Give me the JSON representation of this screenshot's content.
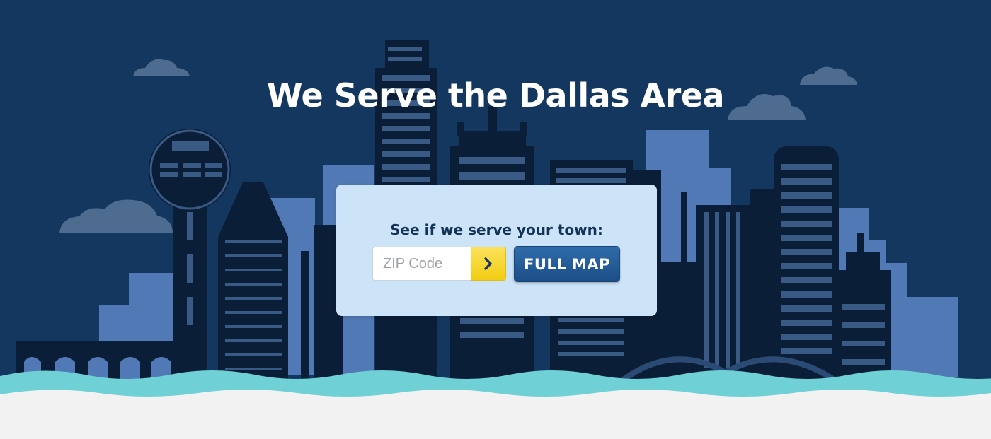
{
  "hero": {
    "title": "We Serve the Dallas Area"
  },
  "zip_search": {
    "heading": "See if we serve your town:",
    "input_placeholder": "ZIP Code",
    "input_value": "",
    "go_icon": "chevron-right-icon",
    "full_map_label": "FULL MAP"
  },
  "colors": {
    "sky": "#14375f",
    "building_dark": "#0b1e37",
    "building_light": "#5179b5",
    "cloud": "#4e6c8f",
    "water": "#6fd0d6",
    "ground": "#f2f2f2",
    "card": "#cde3f7",
    "accent_yellow": "#f5d21b",
    "button_blue": "#245b97"
  }
}
